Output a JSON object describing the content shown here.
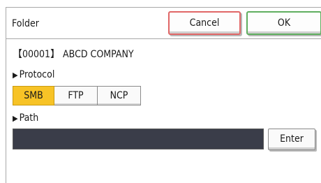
{
  "header": {
    "title": "Folder",
    "cancel_label": "Cancel",
    "ok_label": "OK"
  },
  "destination": {
    "label": "【00001】 ABCD COMPANY"
  },
  "protocol": {
    "heading": "Protocol",
    "options": [
      "SMB",
      "FTP",
      "NCP"
    ],
    "selected": "SMB"
  },
  "path": {
    "heading": "Path",
    "value": "",
    "enter_label": "Enter"
  },
  "colors": {
    "selected": "#f7c326",
    "cancel_border": "#e06666",
    "ok_border": "#5fae5f",
    "path_field": "#3a3d49"
  },
  "icons": {
    "section_marker": "triangle-right-icon"
  }
}
